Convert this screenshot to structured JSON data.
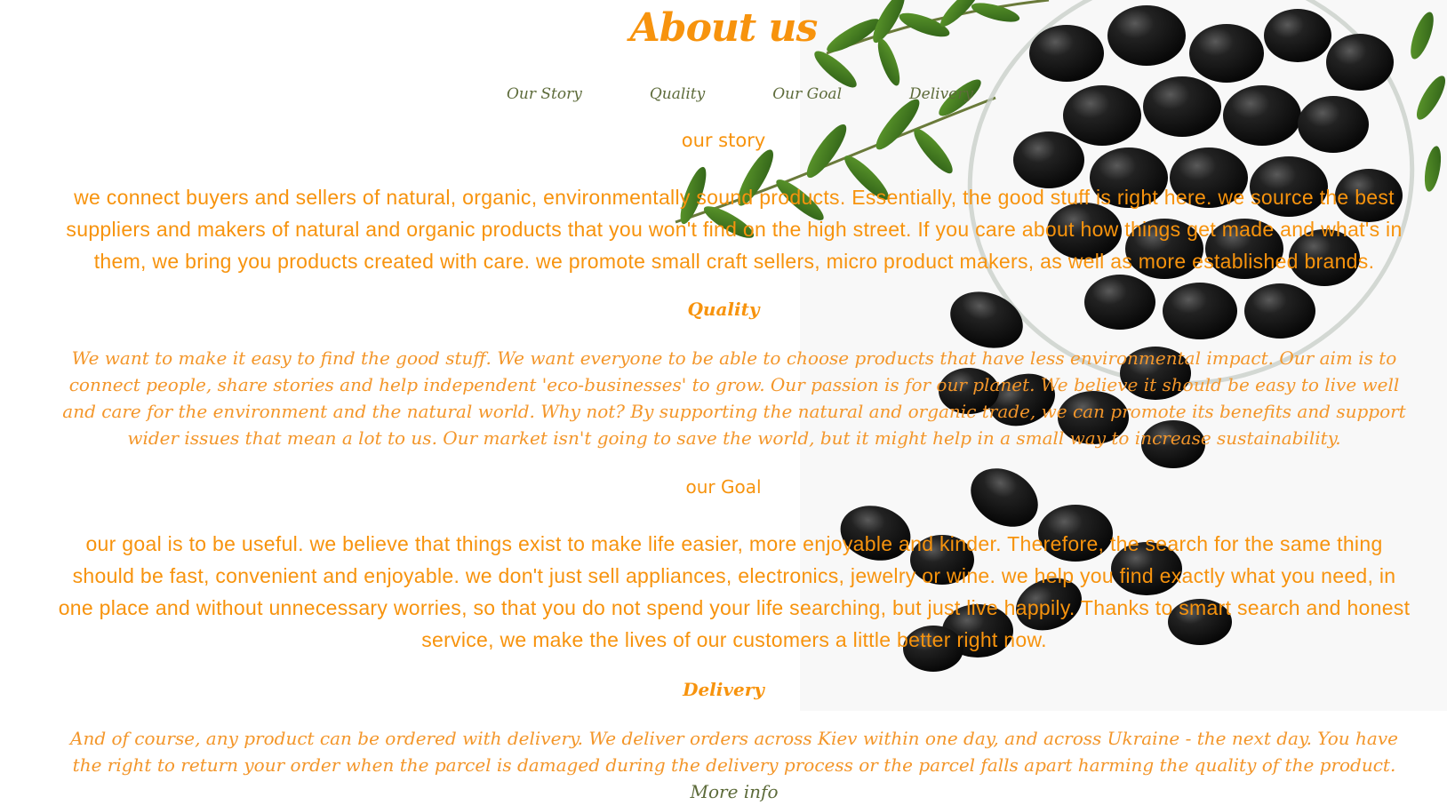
{
  "page": {
    "title": "About us"
  },
  "nav": {
    "items": [
      "Our Story",
      "Quality",
      "Our Goal",
      "Delivery"
    ]
  },
  "sections": {
    "story": {
      "heading": "our story",
      "text": "we connect buyers and sellers of natural, organic, environmentally sound products. Essentially, the good stuff is right here. we source the best suppliers and makers of natural and organic products that you won't find on the high street. If you care about how things get made and what's in them, we bring you products created with care. we promote small craft sellers, micro product makers, as well as more established brands."
    },
    "quality": {
      "heading": "Quality",
      "text": "We want to make it easy to find the good stuff. We want everyone to be able to choose products that have less environmental impact. Our aim is to connect people, share stories and help independent 'eco-businesses' to grow. Our passion is for our planet. We believe it should be easy to live well and care for the environment and the natural world. Why not? By supporting the natural and organic trade, we can promote its benefits and support wider issues that mean a lot to us. Our market isn't going to save the world, but it might help in a small way to increase sustainability."
    },
    "goal": {
      "heading": "our Goal",
      "text": "our goal is to be useful. we believe that things exist to make life easier, more enjoyable and kinder. Therefore, the search for the same thing should be fast, convenient and enjoyable. we don't just sell appliances, electronics, jewelry or wine. we help you find exactly what you need, in one place and without unnecessary worries, so that you do not spend your life searching, but just live happily. Thanks to smart search and honest service, we make the lives of our customers a little better right now."
    },
    "delivery": {
      "heading": "Delivery",
      "text": "And of course, any product can be ordered with delivery. We deliver orders across Kiev within one day, and across Ukraine - the next day. You have the right to return your order when the parcel is damaged during the delivery process or the parcel falls apart harming the quality of the product.",
      "link_label": "More info"
    }
  },
  "colors": {
    "accent_orange": "#f7930d",
    "nav_green": "#5d6b3a",
    "olive_black": "#151515",
    "leaf_green": "#3f7a22"
  }
}
